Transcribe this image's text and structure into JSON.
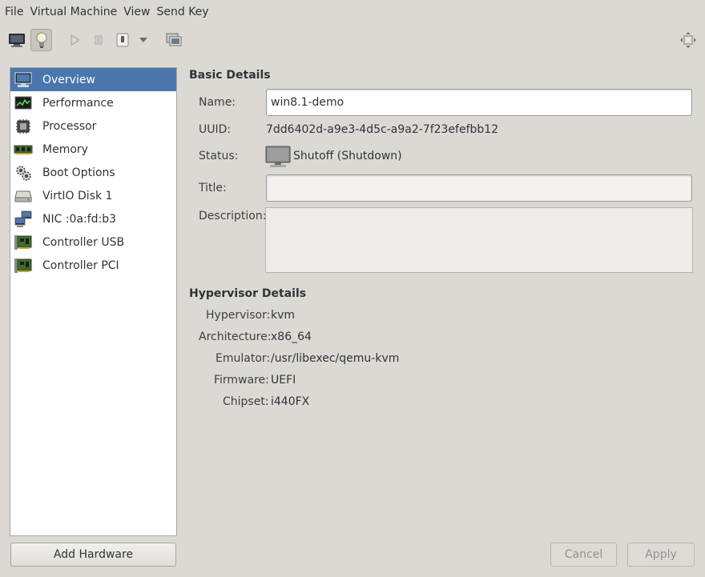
{
  "menubar": {
    "items": [
      "File",
      "Virtual Machine",
      "View",
      "Send Key"
    ]
  },
  "toolbar": {
    "icons": [
      "console-icon",
      "details-lightbulb-icon",
      "run-icon",
      "pause-icon",
      "shutdown-icon",
      "shutdown-menu-icon",
      "snapshots-icon",
      "fullscreen-icon"
    ],
    "active_button": "details-lightbulb-icon"
  },
  "sidebar": {
    "items": [
      {
        "label": "Overview",
        "icon": "monitor-icon",
        "selected": true
      },
      {
        "label": "Performance",
        "icon": "performance-graph-icon"
      },
      {
        "label": "Processor",
        "icon": "cpu-chip-icon"
      },
      {
        "label": "Memory",
        "icon": "memory-stick-icon"
      },
      {
        "label": "Boot Options",
        "icon": "gears-icon"
      },
      {
        "label": "VirtIO Disk 1",
        "icon": "hard-disk-icon"
      },
      {
        "label": "NIC :0a:fd:b3",
        "icon": "network-icon"
      },
      {
        "label": "Controller USB",
        "icon": "controller-card-icon"
      },
      {
        "label": "Controller PCI",
        "icon": "controller-card-icon"
      }
    ],
    "add_hardware_label": "Add Hardware"
  },
  "basic_details": {
    "title": "Basic Details",
    "name_label": "Name:",
    "name_value": "win8.1-demo",
    "uuid_label": "UUID:",
    "uuid_value": "7dd6402d-a9e3-4d5c-a9a2-7f23efefbb12",
    "status_label": "Status:",
    "status_value": "Shutoff (Shutdown)",
    "title_label": "Title:",
    "title_value": "",
    "description_label": "Description:",
    "description_value": ""
  },
  "hypervisor_details": {
    "title": "Hypervisor Details",
    "hypervisor_label": "Hypervisor:",
    "hypervisor_value": "kvm",
    "architecture_label": "Architecture:",
    "architecture_value": "x86_64",
    "emulator_label": "Emulator:",
    "emulator_value": "/usr/libexec/qemu-kvm",
    "firmware_label": "Firmware:",
    "firmware_value": "UEFI",
    "chipset_label": "Chipset:",
    "chipset_value": "i440FX"
  },
  "footer": {
    "cancel_label": "Cancel",
    "apply_label": "Apply"
  },
  "colors": {
    "window_bg": "#dcd9d5",
    "selection": "#4a76ab",
    "sidebar_bg": "#ffffff"
  }
}
